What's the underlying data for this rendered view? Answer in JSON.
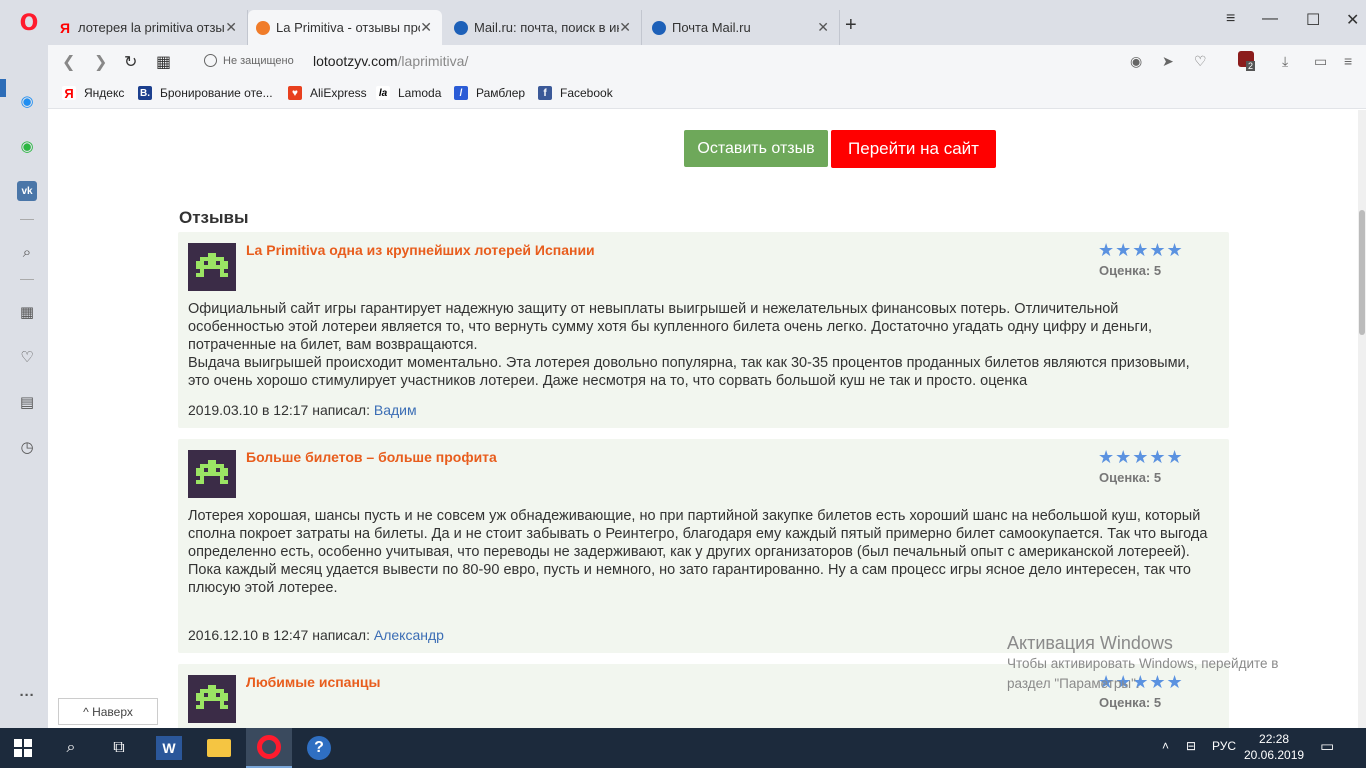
{
  "browser": {
    "tabs": [
      {
        "title": "лотерея la primitiva отзывы",
        "favicon_color": "#ffffff",
        "favicon_text": "Я",
        "active": false
      },
      {
        "title": "La Primitiva - отзывы про л",
        "favicon_color": "#f07c2a",
        "favicon_text": "",
        "active": true
      },
      {
        "title": "Mail.ru: почта, поиск в инт",
        "favicon_color": "#1d60b8",
        "favicon_text": "",
        "active": false
      },
      {
        "title": "Почта Mail.ru",
        "favicon_color": "#1d60b8",
        "favicon_text": "",
        "active": false
      }
    ],
    "security_label": "Не защищено",
    "url_host": "lotootzyv.com",
    "url_path": "/laprimitiva/",
    "bookmarks": [
      {
        "label": "Яндекс",
        "icon": "Я",
        "color": "#ffffff",
        "text_color": "#ff0000"
      },
      {
        "label": "Бронирование оте...",
        "icon": "B.",
        "color": "#1c3f8e",
        "text_color": "#ffffff"
      },
      {
        "label": "AliExpress",
        "icon": "♥",
        "color": "#e8401e",
        "text_color": "#ffffff"
      },
      {
        "label": "Lamoda",
        "icon": "la",
        "color": "#ffffff",
        "text_color": "#000000"
      },
      {
        "label": "Рамблер",
        "icon": "/",
        "color": "#2b5cd6",
        "text_color": "#ffffff"
      },
      {
        "label": "Facebook",
        "icon": "f",
        "color": "#3b5998",
        "text_color": "#ffffff"
      }
    ],
    "extension_badge": "2"
  },
  "page": {
    "buttons": {
      "leave_review": "Оставить отзыв",
      "go_to_site": "Перейти на сайт"
    },
    "section_title": "Отзывы",
    "reviews": [
      {
        "title": "La Primitiva одна из крупнейших лотерей Испании",
        "stars": "★★★★★",
        "rating_label": "Оценка: 5",
        "paragraphs": [
          "Официальный сайт игры гарантирует надежную защиту от невыплаты выигрышей и нежелательных финансовых потерь. Отличительной особенностью этой лотереи является то, что вернуть сумму хотя бы купленного билета очень легко. Достаточно угадать одну цифру и деньги, потраченные на билет, вам возвращаются.",
          "Выдача выигрышей происходит моментально. Эта лотерея довольно популярна, так как 30-35 процентов проданных билетов являются призовыми, это очень хорошо стимулирует участников лотереи. Даже несмотря на то, что сорвать большой куш не так и просто. оценка"
        ],
        "date": "2019.03.10 в 12:17 написал:",
        "author": "Вадим"
      },
      {
        "title": "Больше билетов – больше профита",
        "stars": "★★★★★",
        "rating_label": "Оценка: 5",
        "paragraphs": [
          "Лотерея хорошая, шансы пусть и не совсем уж обнадеживающие, но при партийной закупке билетов есть хороший шанс на небольшой куш, который сполна покроет затраты на билеты. Да и не стоит забывать о Реинтегро, благодаря ему каждый пятый примерно билет самоокупается. Так что выгода определенно есть, особенно учитывая, что переводы не задерживают, как у других организаторов (был печальный опыт с американской лотереей).",
          "Пока каждый месяц удается вывести по 80-90 евро, пусть и немного, но зато гарантированно. Ну а сам процесс игры ясное дело интересен, так что плюсую этой лотерее."
        ],
        "date": "2016.12.10 в 12:47 написал:",
        "author": "Александр"
      },
      {
        "title": "Любимые испанцы",
        "stars": "★★★★★",
        "rating_label": "Оценка: 5"
      }
    ],
    "back_to_top": "^ Наверх"
  },
  "os": {
    "activation_title": "Активация Windows",
    "activation_line1": "Чтобы активировать Windows, перейдите в",
    "activation_line2": "раздел \"Параметры\".",
    "tray_lang": "РУС",
    "time": "22:28",
    "date": "20.06.2019"
  }
}
